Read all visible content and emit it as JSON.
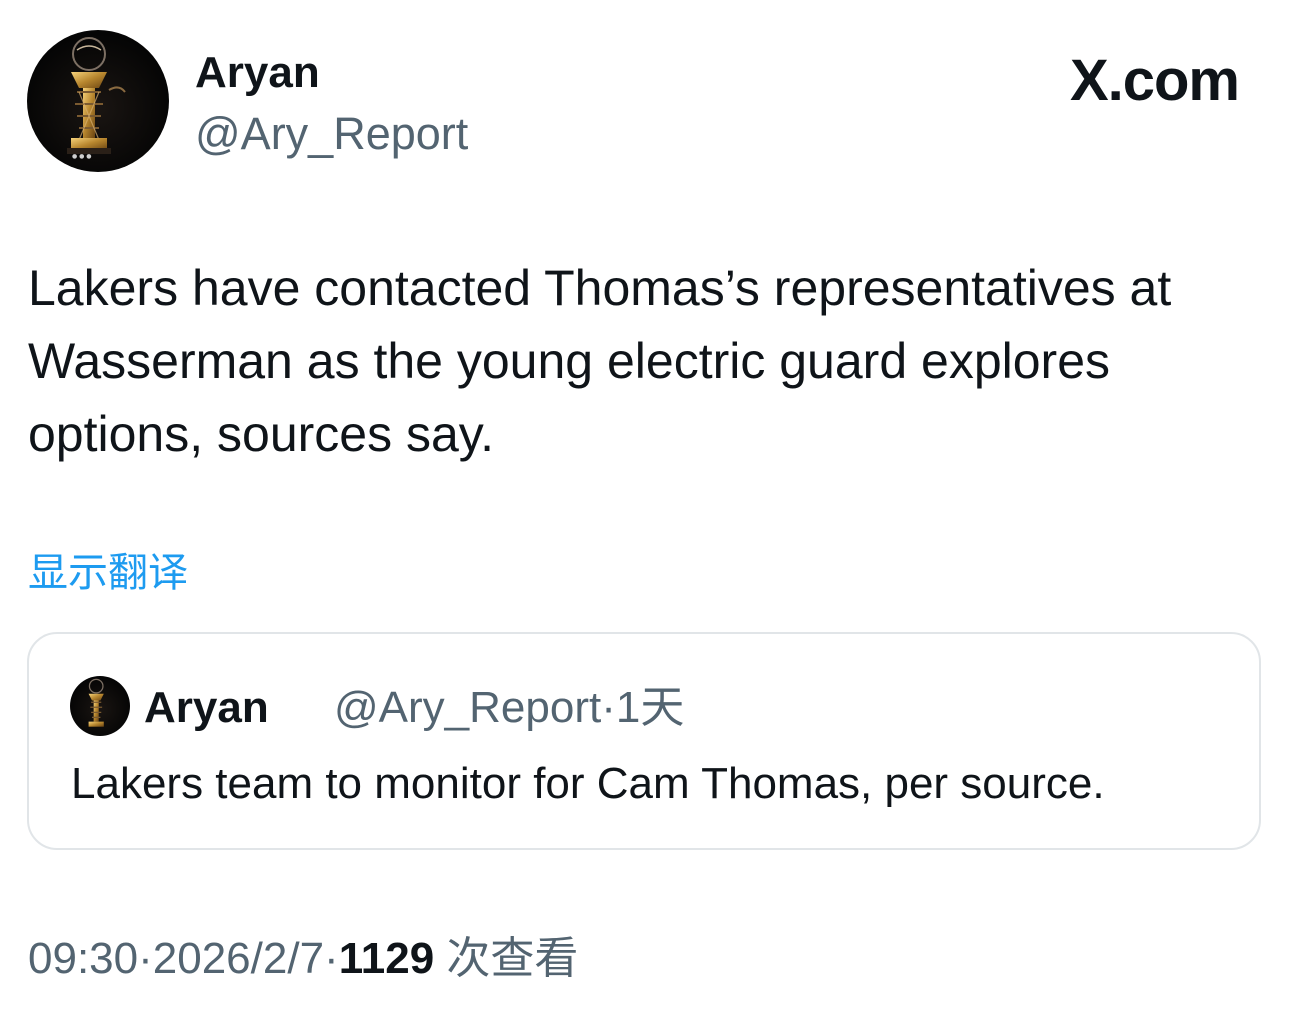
{
  "author": {
    "display_name": "Aryan",
    "handle": "@Ary_Report",
    "avatar_icon": "trophy-avatar-icon"
  },
  "brand": {
    "label": "X.com"
  },
  "tweet": {
    "text": "Lakers have contacted Thomas’s representatives at Wasserman as the young electric guard explores options, sources say.",
    "translate_label": "显示翻译"
  },
  "quoted_tweet": {
    "display_name": "Aryan",
    "handle": "@Ary_Report",
    "separator": "·",
    "time": "1天",
    "text": "Lakers team to monitor for Cam Thomas, per source."
  },
  "footer": {
    "time": "09:30",
    "separator": "·",
    "date": "2026/2/7",
    "views_count": "1129",
    "views_label": "次查看"
  },
  "colors": {
    "link": "#1d9bf0",
    "secondary_text": "#536471",
    "primary_text": "#0f1419",
    "card_border": "#e1e5e8"
  }
}
